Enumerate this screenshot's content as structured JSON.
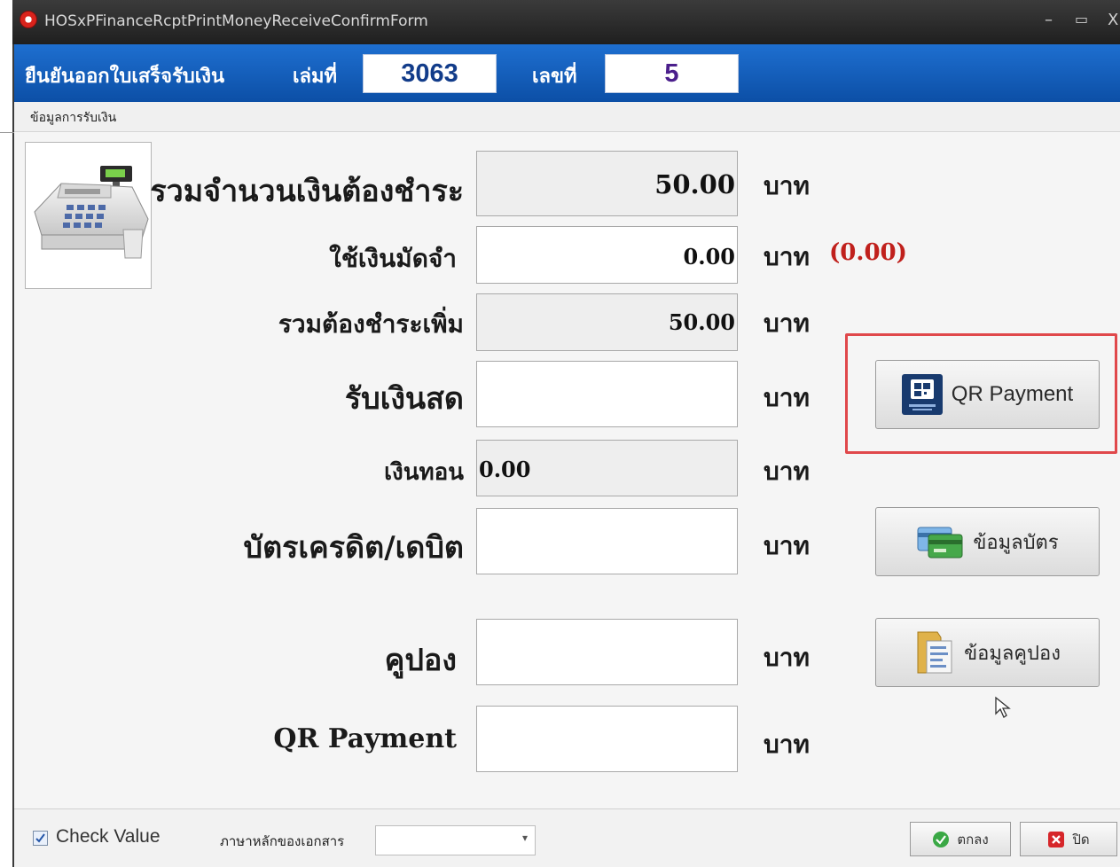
{
  "window": {
    "title": "HOSxPFinanceRcptPrintMoneyReceiveConfirmForm",
    "minimize": "–",
    "maximize": "▭",
    "close": "X"
  },
  "header": {
    "title": "ยืนยันออกใบเสร็จรับเงิน",
    "book_label": "เล่มที่",
    "book_value": "3063",
    "number_label": "เลขที่",
    "number_value": "5"
  },
  "section": {
    "label": "ข้อมูลการรับเงิน"
  },
  "form": {
    "total_label": "รวมจำนวนเงินต้องชำระ",
    "total_value": "50.00",
    "deposit_label": "ใช้เงินมัดจำ",
    "deposit_value": "0.00",
    "deposit_extra": "(0.00)",
    "remaining_label": "รวมต้องชำระเพิ่ม",
    "remaining_value": "50.00",
    "cash_label": "รับเงินสด",
    "cash_value": "",
    "change_label": "เงินทอน",
    "change_value": "0.00",
    "card_label": "บัตรเครดิต/เดบิต",
    "card_value": "",
    "coupon_label": "คูปอง",
    "coupon_value": "",
    "qr_label": "QR Payment",
    "qr_value": "",
    "unit": "บาท"
  },
  "buttons": {
    "qr_payment": "QR Payment",
    "card_info": "ข้อมูลบัตร",
    "coupon_info": "ข้อมูลคูปอง",
    "ok": "ตกลง",
    "close": "ปิด"
  },
  "bottom": {
    "check_value_label": "Check Value",
    "check_value_checked": true,
    "language_label": "ภาษาหลักของเอกสาร",
    "language_value": ""
  },
  "colors": {
    "header_blue": "#0c4fa6",
    "highlight_red": "#e0484b",
    "amount_red": "#c0201c"
  }
}
